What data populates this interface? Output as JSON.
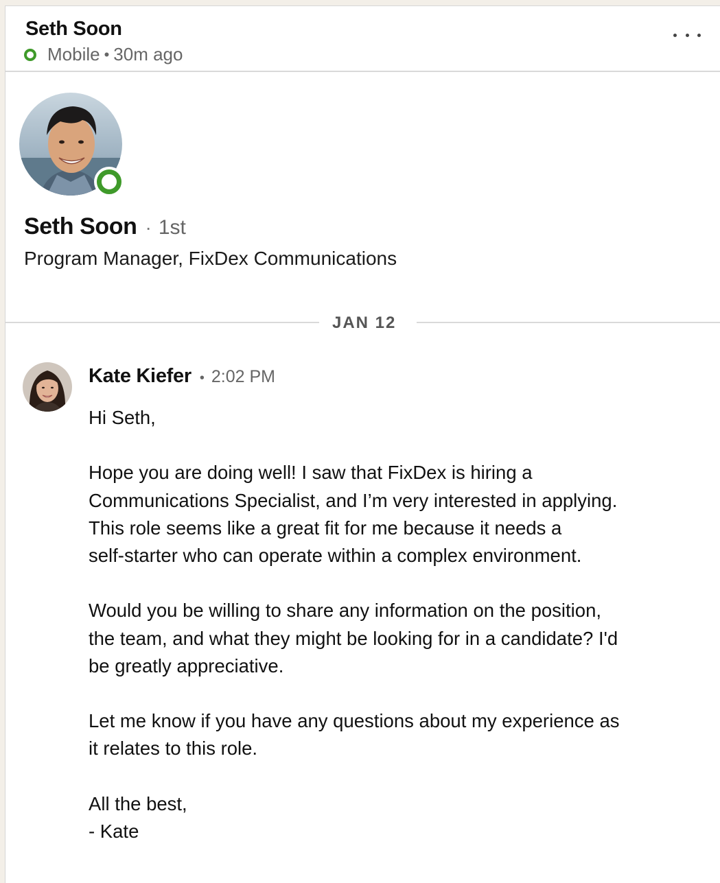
{
  "header": {
    "name": "Seth Soon",
    "device": "Mobile",
    "separator": "•",
    "last_active": "30m ago",
    "more_icon": "ellipsis-icon"
  },
  "profile": {
    "name": "Seth Soon",
    "degree_separator": "·",
    "degree": "1st",
    "headline": "Program Manager, FixDex Communications",
    "online": true
  },
  "date_divider": "JAN 12",
  "message": {
    "sender": "Kate Kiefer",
    "separator": "•",
    "time": "2:02 PM",
    "lines": {
      "greeting": "Hi Seth,",
      "p1_l1": "Hope you are doing well! I saw that FixDex is hiring a",
      "p1_l2": "Communications Specialist, and I’m very interested in applying.",
      "p1_l3": "This role seems like a great fit for me because it needs a",
      "p1_l4": "self-starter who can operate within a complex environment.",
      "p2_l1": "Would you be willing to share any information on the position,",
      "p2_l2": "the team, and what they might be looking for in a candidate? I'd",
      "p2_l3": "be greatly appreciative.",
      "p3_l1": "Let me know if you have any questions about my experience as",
      "p3_l2": "it relates to this role.",
      "signoff": "All the best,",
      "signature": "- Kate"
    }
  },
  "colors": {
    "online_green": "#3f9a2a",
    "divider": "#d9d9d9",
    "muted_text": "#666666"
  }
}
